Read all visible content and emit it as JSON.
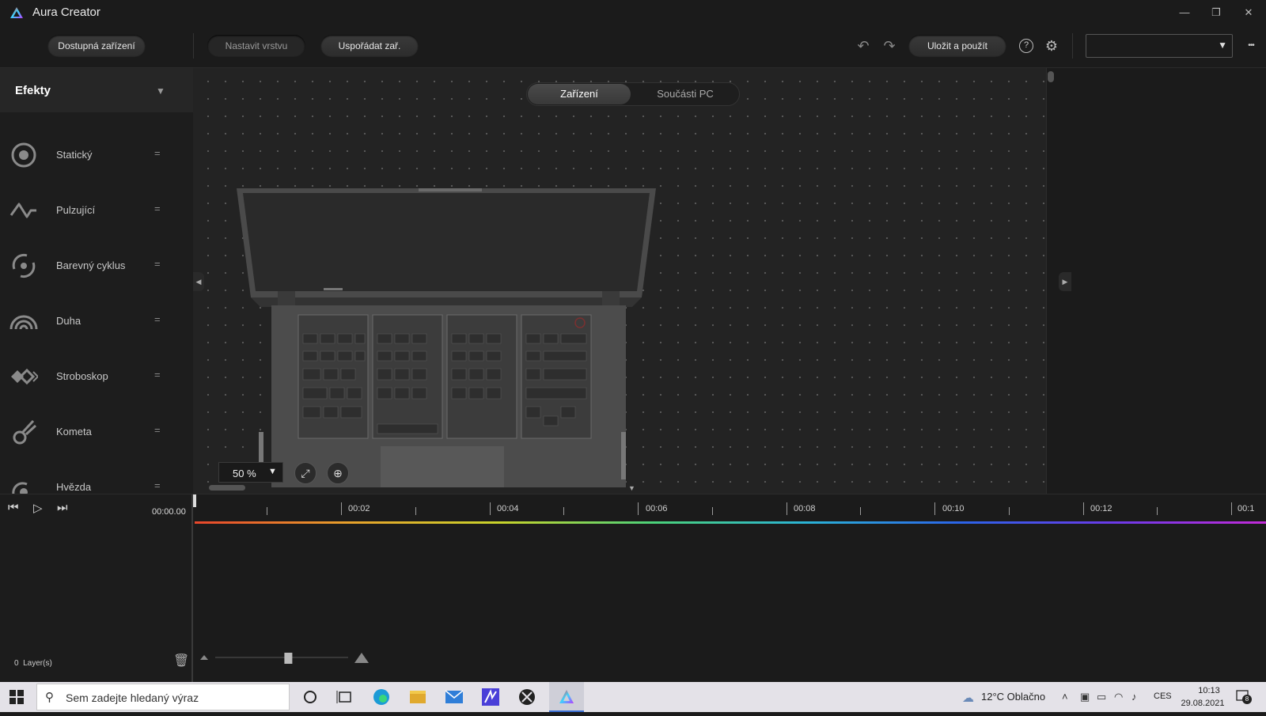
{
  "app": {
    "title": "Aura Creator"
  },
  "window_controls": {
    "minimize": "—",
    "restore": "❐",
    "close": "✕"
  },
  "toolbar": {
    "available_devices": "Dostupná zařízení",
    "set_layer": "Nastavit vrstvu",
    "arrange_devices": "Uspořádat zař.",
    "save_apply": "Uložit a použít",
    "undo_icon": "↶",
    "redo_icon": "↷",
    "help_icon": "?",
    "settings_icon": "⚙",
    "more_icon": "•••",
    "profile_value": ""
  },
  "effects": {
    "title": "Efekty",
    "items": [
      {
        "label": "Statický",
        "icon": "static-icon"
      },
      {
        "label": "Pulzující",
        "icon": "pulse-icon"
      },
      {
        "label": "Barevný cyklus",
        "icon": "color-cycle-icon"
      },
      {
        "label": "Duha",
        "icon": "rainbow-icon"
      },
      {
        "label": "Stroboskop",
        "icon": "strobe-icon"
      },
      {
        "label": "Kometa",
        "icon": "comet-icon"
      },
      {
        "label": "Hvězda",
        "icon": "star-icon"
      }
    ]
  },
  "canvas": {
    "tabs": [
      "Zařízení",
      "Součásti PC"
    ],
    "active_tab": "Zařízení",
    "zoom": "50 %"
  },
  "timeline": {
    "time": "00:00.00",
    "ticks": [
      "00:02",
      "00:04",
      "00:06",
      "00:08",
      "00:10",
      "00:12",
      "00:1"
    ],
    "layers_count": "0",
    "layers_label": "Layer(s)",
    "zoom_slider_level": 0.55
  },
  "taskbar": {
    "search_placeholder": "Sem zadejte hledaný výraz",
    "weather": "12°C  Oblačno",
    "language": "CES",
    "time": "10:13",
    "date": "29.08.2021",
    "notifications": "8"
  },
  "colors": {
    "accent": "#e8462b",
    "bg": "#1b1b1b",
    "taskbar": "#e4e2e8"
  }
}
